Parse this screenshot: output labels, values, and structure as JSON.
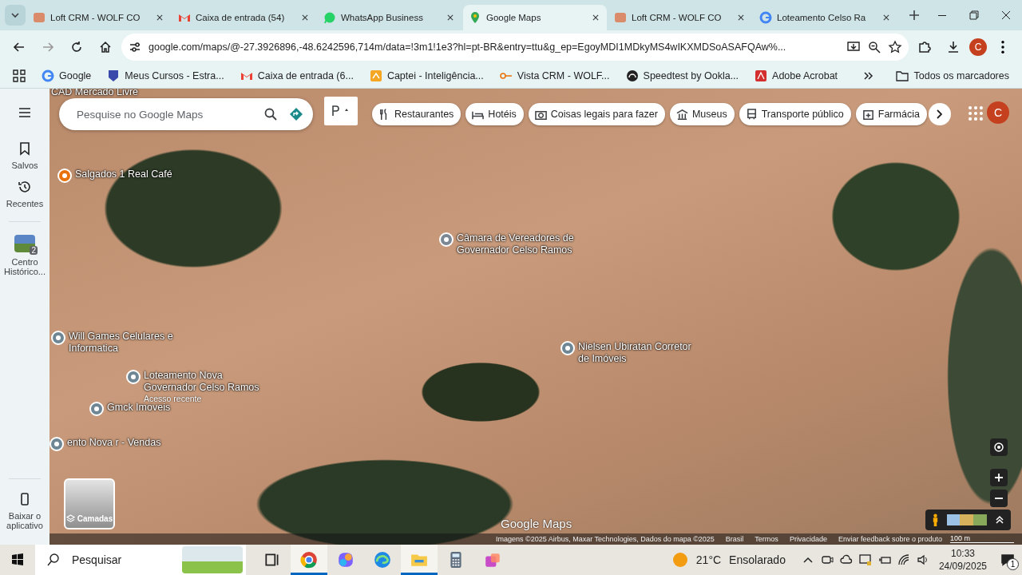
{
  "tabs": [
    {
      "label": "Loft CRM - WOLF CO",
      "kind": "loft",
      "selected": false
    },
    {
      "label": "Caixa de entrada (54)",
      "kind": "gmail",
      "selected": false
    },
    {
      "label": "WhatsApp Business",
      "kind": "whatsapp",
      "selected": false
    },
    {
      "label": "Google Maps",
      "kind": "maps",
      "selected": true
    },
    {
      "label": "Loft CRM - WOLF CO",
      "kind": "loft",
      "selected": false
    },
    {
      "label": "Loteamento Celso Ra",
      "kind": "google",
      "selected": false
    }
  ],
  "address_bar": {
    "url": "google.com/maps/@-27.3926896,-48.6242596,714m/data=!3m1!1e3?hl=pt-BR&entry=ttu&g_ep=EgoyMDI1MDkyMS4wIKXMDSoASAFQAw%..."
  },
  "profile": {
    "initial": "C"
  },
  "bookmarks": [
    {
      "label": "Google",
      "kind": "google"
    },
    {
      "label": "Meus Cursos - Estra...",
      "kind": "shield"
    },
    {
      "label": "Caixa de entrada (6...",
      "kind": "gmail"
    },
    {
      "label": "Captei - Inteligência...",
      "kind": "captei"
    },
    {
      "label": "Vista CRM - WOLF...",
      "kind": "key"
    },
    {
      "label": "Speedtest by Ookla...",
      "kind": "speedtest"
    },
    {
      "label": "Adobe Acrobat",
      "kind": "acrobat"
    }
  ],
  "all_bookmarks": "Todos os marcadores",
  "rail": {
    "items": [
      {
        "label": "Salvos",
        "kind": "bookmark"
      },
      {
        "label": "Recentes",
        "kind": "history"
      }
    ],
    "recent_place": {
      "label": "Centro Histórico...",
      "count": "2"
    },
    "download": "Baixar o aplicativo"
  },
  "search": {
    "placeholder": "Pesquise no Google Maps"
  },
  "chips": [
    {
      "label": "Restaurantes",
      "kind": "fork"
    },
    {
      "label": "Hotéis",
      "kind": "bed"
    },
    {
      "label": "Coisas legais para fazer",
      "kind": "camera"
    },
    {
      "label": "Museus",
      "kind": "museum"
    },
    {
      "label": "Transporte público",
      "kind": "bus"
    },
    {
      "label": "Farmácia",
      "kind": "pharmacy"
    }
  ],
  "account": {
    "initial": "C"
  },
  "places": [
    {
      "name": "CAD Mercado Livre",
      "kind": "label"
    },
    {
      "name": "Salgados 1 Real Café",
      "kind": "restaurant"
    },
    {
      "name": "Câmara de Vereadores de Governador Celso Ramos",
      "kind": "government"
    },
    {
      "name": "Will Games Celulares e Informatica",
      "kind": "place"
    },
    {
      "name": "Loteamento Nova Governador Celso Ramos",
      "note": "Acesso recente",
      "kind": "place"
    },
    {
      "name": "Gmck Imoveis",
      "kind": "place"
    },
    {
      "name": "ento Nova r - Vendas",
      "kind": "place"
    },
    {
      "name": "Nielsen Ubiratan Corretor de Imóveis",
      "kind": "place"
    }
  ],
  "layers_button": "Camadas",
  "logo": "Google Maps",
  "attribution": [
    "Imagens ©2025 Airbus, Maxar Technologies, Dados do mapa ©2025",
    "Brasil",
    "Termos",
    "Privacidade",
    "Enviar feedback sobre o produto"
  ],
  "scale": "100 m",
  "taskbar": {
    "search_placeholder": "Pesquisar",
    "apps": [
      {
        "kind": "taskview",
        "running": false
      },
      {
        "kind": "chrome",
        "running": true
      },
      {
        "kind": "copilot",
        "running": false
      },
      {
        "kind": "edge",
        "running": false
      },
      {
        "kind": "explorer",
        "running": true
      },
      {
        "kind": "calculator",
        "running": false
      },
      {
        "kind": "office",
        "running": false
      }
    ],
    "weather": {
      "temp": "21°C",
      "condition": "Ensolarado"
    },
    "time": "10:33",
    "date": "24/09/2025",
    "notifications": "1"
  }
}
